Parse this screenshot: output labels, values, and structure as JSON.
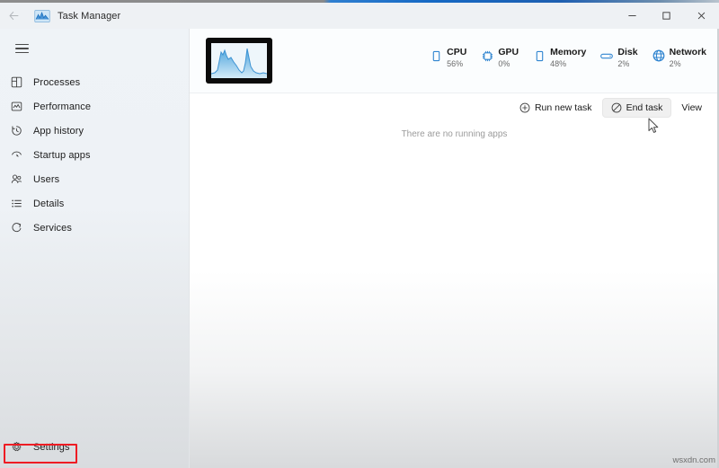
{
  "window": {
    "title": "Task Manager",
    "app_icon": "task-manager-icon",
    "back_label": "←",
    "controls": {
      "minimize": "–",
      "maximize": "□",
      "close": "✕"
    }
  },
  "sidebar": {
    "menu_icon": "hamburger-icon",
    "items": [
      {
        "label": "Processes",
        "icon": "processes-icon"
      },
      {
        "label": "Performance",
        "icon": "performance-icon"
      },
      {
        "label": "App history",
        "icon": "app-history-icon"
      },
      {
        "label": "Startup apps",
        "icon": "startup-apps-icon"
      },
      {
        "label": "Users",
        "icon": "users-icon"
      },
      {
        "label": "Details",
        "icon": "details-icon"
      },
      {
        "label": "Services",
        "icon": "services-icon"
      }
    ],
    "settings": {
      "label": "Settings",
      "icon": "gear-icon"
    }
  },
  "header": {
    "thumbnail_name": "performance-graph-thumbnail",
    "stats": [
      {
        "name": "CPU",
        "value": "56%",
        "icon": "cpu-icon"
      },
      {
        "name": "GPU",
        "value": "0%",
        "icon": "gpu-icon"
      },
      {
        "name": "Memory",
        "value": "48%",
        "icon": "memory-icon"
      },
      {
        "name": "Disk",
        "value": "2%",
        "icon": "disk-icon"
      },
      {
        "name": "Network",
        "value": "2%",
        "icon": "network-icon"
      }
    ]
  },
  "toolbar": {
    "run_new_task": "Run new task",
    "end_task": "End task",
    "view": "View"
  },
  "main": {
    "empty_message": "There are no running apps"
  },
  "annotation": {
    "highlight_color": "#ee1c24",
    "highlight_target": "Settings"
  },
  "watermark": "wsxdn.com"
}
